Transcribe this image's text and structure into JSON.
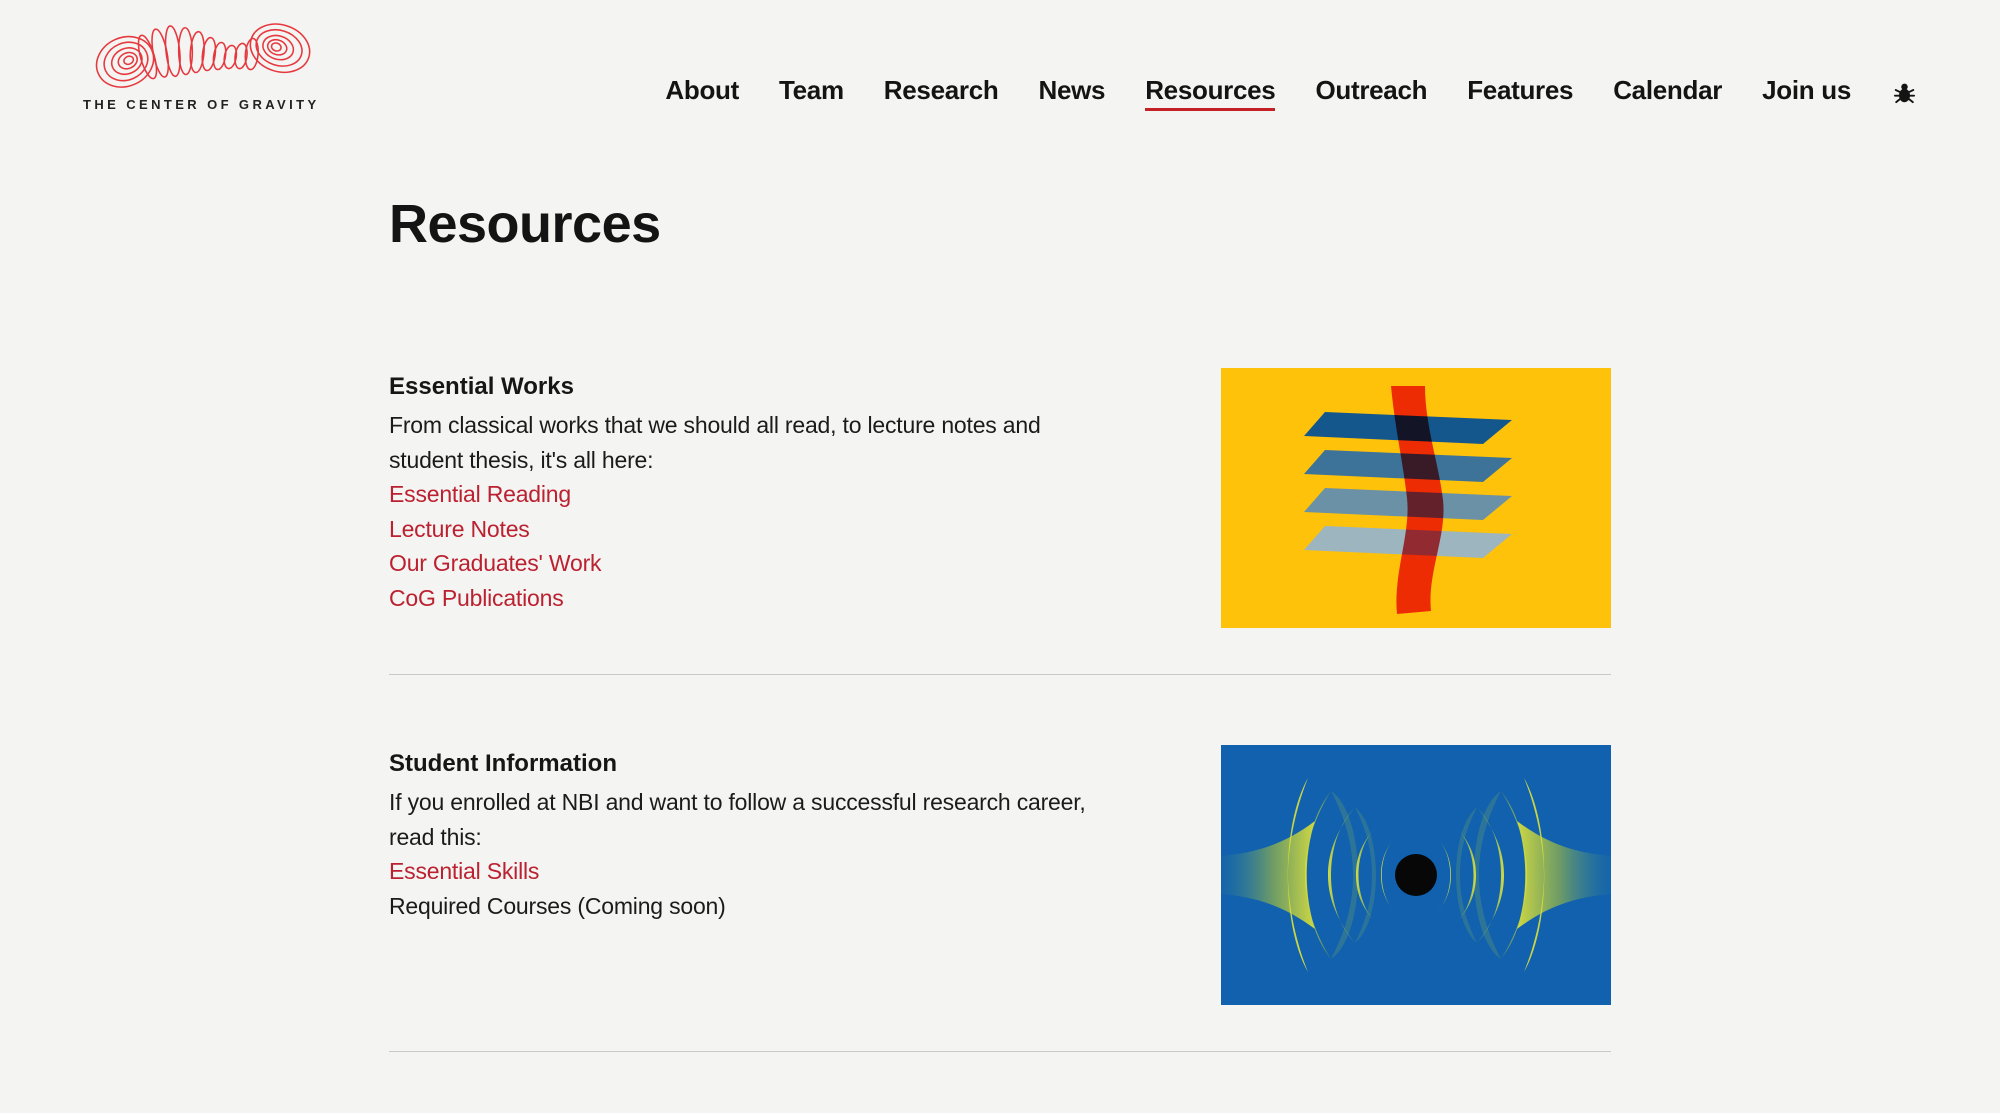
{
  "brand": {
    "name": "THE CENTER OF GRAVITY",
    "logo_icon": "gravity-wave-scribble-icon"
  },
  "nav": {
    "items": [
      {
        "label": "About",
        "active": false
      },
      {
        "label": "Team",
        "active": false
      },
      {
        "label": "Research",
        "active": false
      },
      {
        "label": "News",
        "active": false
      },
      {
        "label": "Resources",
        "active": true
      },
      {
        "label": "Outreach",
        "active": false
      },
      {
        "label": "Features",
        "active": false
      },
      {
        "label": "Calendar",
        "active": false
      },
      {
        "label": "Join us",
        "active": false
      }
    ],
    "trailing_icon": "bug-icon"
  },
  "page": {
    "title": "Resources"
  },
  "sections": [
    {
      "heading": "Essential Works",
      "description": "From classical works that we should all read, to lecture notes and\nstudent thesis, it's all here:",
      "links": [
        "Essential Reading",
        "Lecture Notes",
        "Our Graduates' Work",
        "CoG Publications"
      ],
      "plain_items": [],
      "illustration": "stacked-blue-planes-with-red-ribbon-on-yellow"
    },
    {
      "heading": "Student Information",
      "description": "If you enrolled at NBI and want to follow a successful research career,\nread this:",
      "links": [
        "Essential Skills"
      ],
      "plain_items": [
        "Required Courses (Coming soon)"
      ],
      "illustration": "black-hole-with-gravitational-waves-on-blue"
    }
  ],
  "colors": {
    "page-bg": "#f4f4f2",
    "text": "#151515",
    "accent-link": "#bb2130",
    "accent-underline": "#c42127",
    "logo-red": "#e6393f",
    "illustration-yellow": "#fec20a",
    "illustration-blue": "#1161ae"
  }
}
